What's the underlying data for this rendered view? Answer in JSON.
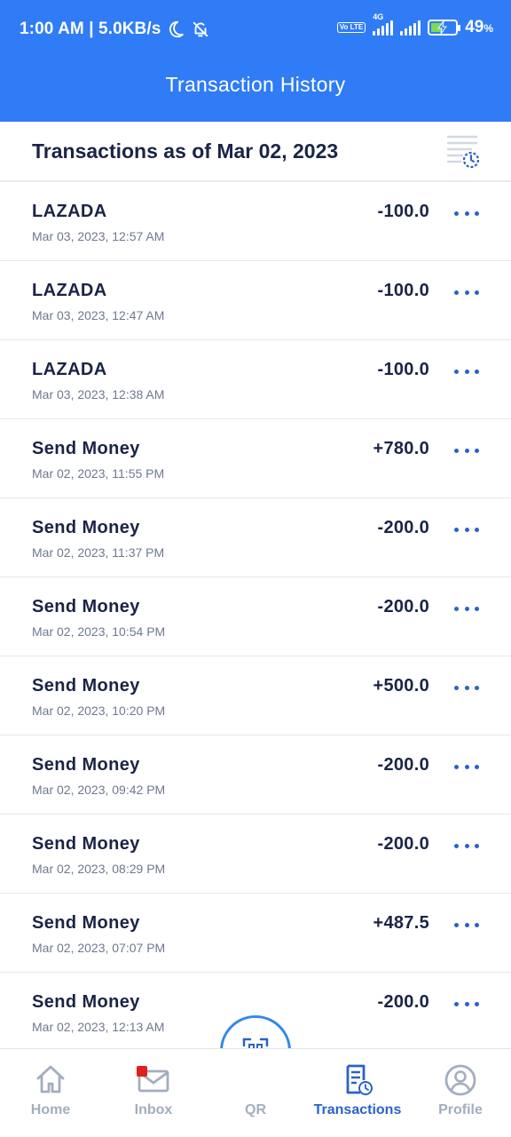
{
  "status_bar": {
    "time_speed": "1:00 AM | 5.0KB/s",
    "volte": "Vo LTE",
    "net_type": "4G",
    "battery_pct": "49",
    "battery_unit": "%"
  },
  "header": {
    "title": "Transaction History"
  },
  "subheader": {
    "title": "Transactions as of Mar 02, 2023"
  },
  "transactions": [
    {
      "name": "LAZADA",
      "date": "Mar 03, 2023, 12:57 AM",
      "amount": "-100.0"
    },
    {
      "name": "LAZADA",
      "date": "Mar 03, 2023, 12:47 AM",
      "amount": "-100.0"
    },
    {
      "name": "LAZADA",
      "date": "Mar 03, 2023, 12:38 AM",
      "amount": "-100.0"
    },
    {
      "name": "Send Money",
      "date": "Mar 02, 2023, 11:55 PM",
      "amount": "+780.0"
    },
    {
      "name": "Send Money",
      "date": "Mar 02, 2023, 11:37 PM",
      "amount": "-200.0"
    },
    {
      "name": "Send Money",
      "date": "Mar 02, 2023, 10:54 PM",
      "amount": "-200.0"
    },
    {
      "name": "Send Money",
      "date": "Mar 02, 2023, 10:20 PM",
      "amount": "+500.0"
    },
    {
      "name": "Send Money",
      "date": "Mar 02, 2023, 09:42 PM",
      "amount": "-200.0"
    },
    {
      "name": "Send Money",
      "date": "Mar 02, 2023, 08:29 PM",
      "amount": "-200.0"
    },
    {
      "name": "Send Money",
      "date": "Mar 02, 2023, 07:07 PM",
      "amount": "+487.5"
    },
    {
      "name": "Send Money",
      "date": "Mar 02, 2023, 12:13 AM",
      "amount": "-200.0"
    }
  ],
  "bottom_nav": {
    "items": [
      {
        "label": "Home",
        "icon": "home-icon"
      },
      {
        "label": "Inbox",
        "icon": "mail-icon"
      },
      {
        "label": "QR",
        "icon": "qr-scan-icon"
      },
      {
        "label": "Transactions",
        "icon": "receipt-clock-icon"
      },
      {
        "label": "Profile",
        "icon": "user-circle-icon"
      }
    ],
    "active": "Transactions"
  },
  "colors": {
    "header_bg": "#2f7cf6",
    "primary_text": "#1a2446",
    "accent": "#2a62c8",
    "inactive_nav": "#a3adbf",
    "notification_badge": "#e01f1f"
  }
}
